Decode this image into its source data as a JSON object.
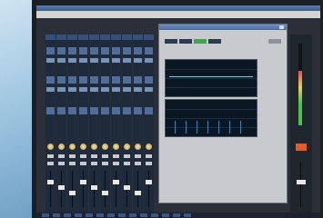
{
  "app": {
    "title": ""
  },
  "menu": [],
  "panel": {
    "title": ""
  },
  "colors": {
    "accent": "#3ca54d",
    "master_indicator": "#e85a22",
    "strip_header": "#36507a"
  },
  "strips_count": 10
}
